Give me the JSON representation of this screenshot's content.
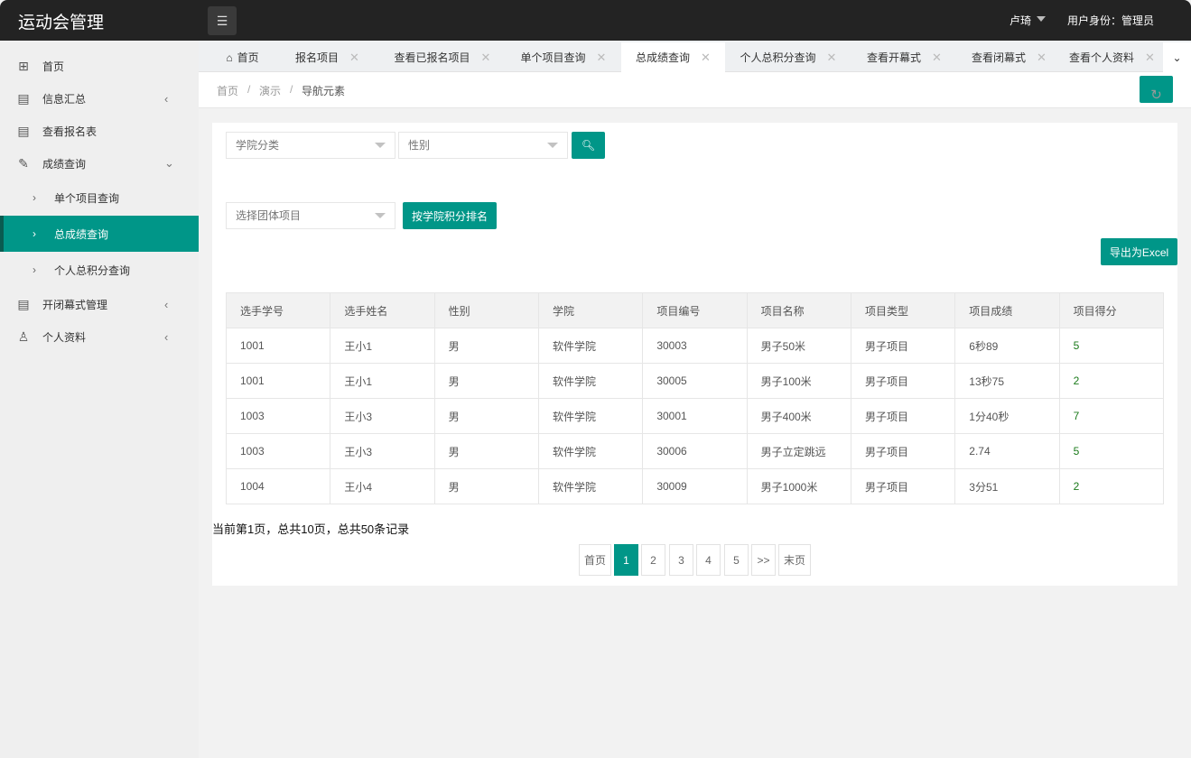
{
  "header": {
    "title": "运动会管理",
    "user": "卢琦",
    "role": "用户身份：管理员"
  },
  "sidebar": {
    "items": [
      {
        "label": "首页",
        "icon": "grid-icon"
      },
      {
        "label": "信息汇总",
        "icon": "summary-icon"
      },
      {
        "label": "查看报名表",
        "icon": "form-icon"
      },
      {
        "label": "成绩查询",
        "icon": "edit-icon"
      },
      {
        "label": "单个项目查询"
      },
      {
        "label": "总成绩查询"
      },
      {
        "label": "个人总积分查询"
      },
      {
        "label": "开闭幕式管理",
        "icon": "ceremony-icon"
      },
      {
        "label": "个人资料",
        "icon": "user-icon"
      }
    ]
  },
  "tabs": [
    {
      "label": "首页"
    },
    {
      "label": "报名项目"
    },
    {
      "label": "查看已报名项目"
    },
    {
      "label": "单个项目查询"
    },
    {
      "label": "总成绩查询"
    },
    {
      "label": "个人总积分查询"
    },
    {
      "label": "查看开幕式"
    },
    {
      "label": "查看闭幕式"
    },
    {
      "label": "查看个人资料"
    }
  ],
  "breadcrumb": [
    "首页",
    "演示",
    "导航元素"
  ],
  "filters": {
    "college": "学院分类",
    "gender": "性别",
    "team": "选择团体项目",
    "rank_btn": "按学院积分排名",
    "export_btn": "导出为Excel"
  },
  "table": {
    "headers": [
      "选手学号",
      "选手姓名",
      "性别",
      "学院",
      "项目编号",
      "项目名称",
      "项目类型",
      "项目成绩",
      "项目得分"
    ],
    "rows": [
      [
        "1001",
        "王小1",
        "男",
        "软件学院",
        "30003",
        "男子50米",
        "男子项目",
        "6秒89",
        "5"
      ],
      [
        "1001",
        "王小1",
        "男",
        "软件学院",
        "30005",
        "男子100米",
        "男子项目",
        "13秒75",
        "2"
      ],
      [
        "1003",
        "王小3",
        "男",
        "软件学院",
        "30001",
        "男子400米",
        "男子项目",
        "1分40秒",
        "7"
      ],
      [
        "1003",
        "王小3",
        "男",
        "软件学院",
        "30006",
        "男子立定跳远",
        "男子项目",
        "2.74",
        "5"
      ],
      [
        "1004",
        "王小4",
        "男",
        "软件学院",
        "30009",
        "男子1000米",
        "男子项目",
        "3分51",
        "2"
      ]
    ]
  },
  "pagination": {
    "info": "当前第1页，总共10页，总共50条记录",
    "first": "首页",
    "pages": [
      "1",
      "2",
      "3",
      "4",
      "5"
    ],
    "next": ">>",
    "last": "末页"
  },
  "colors": {
    "accent": "#009688",
    "topbar": "#232323"
  }
}
